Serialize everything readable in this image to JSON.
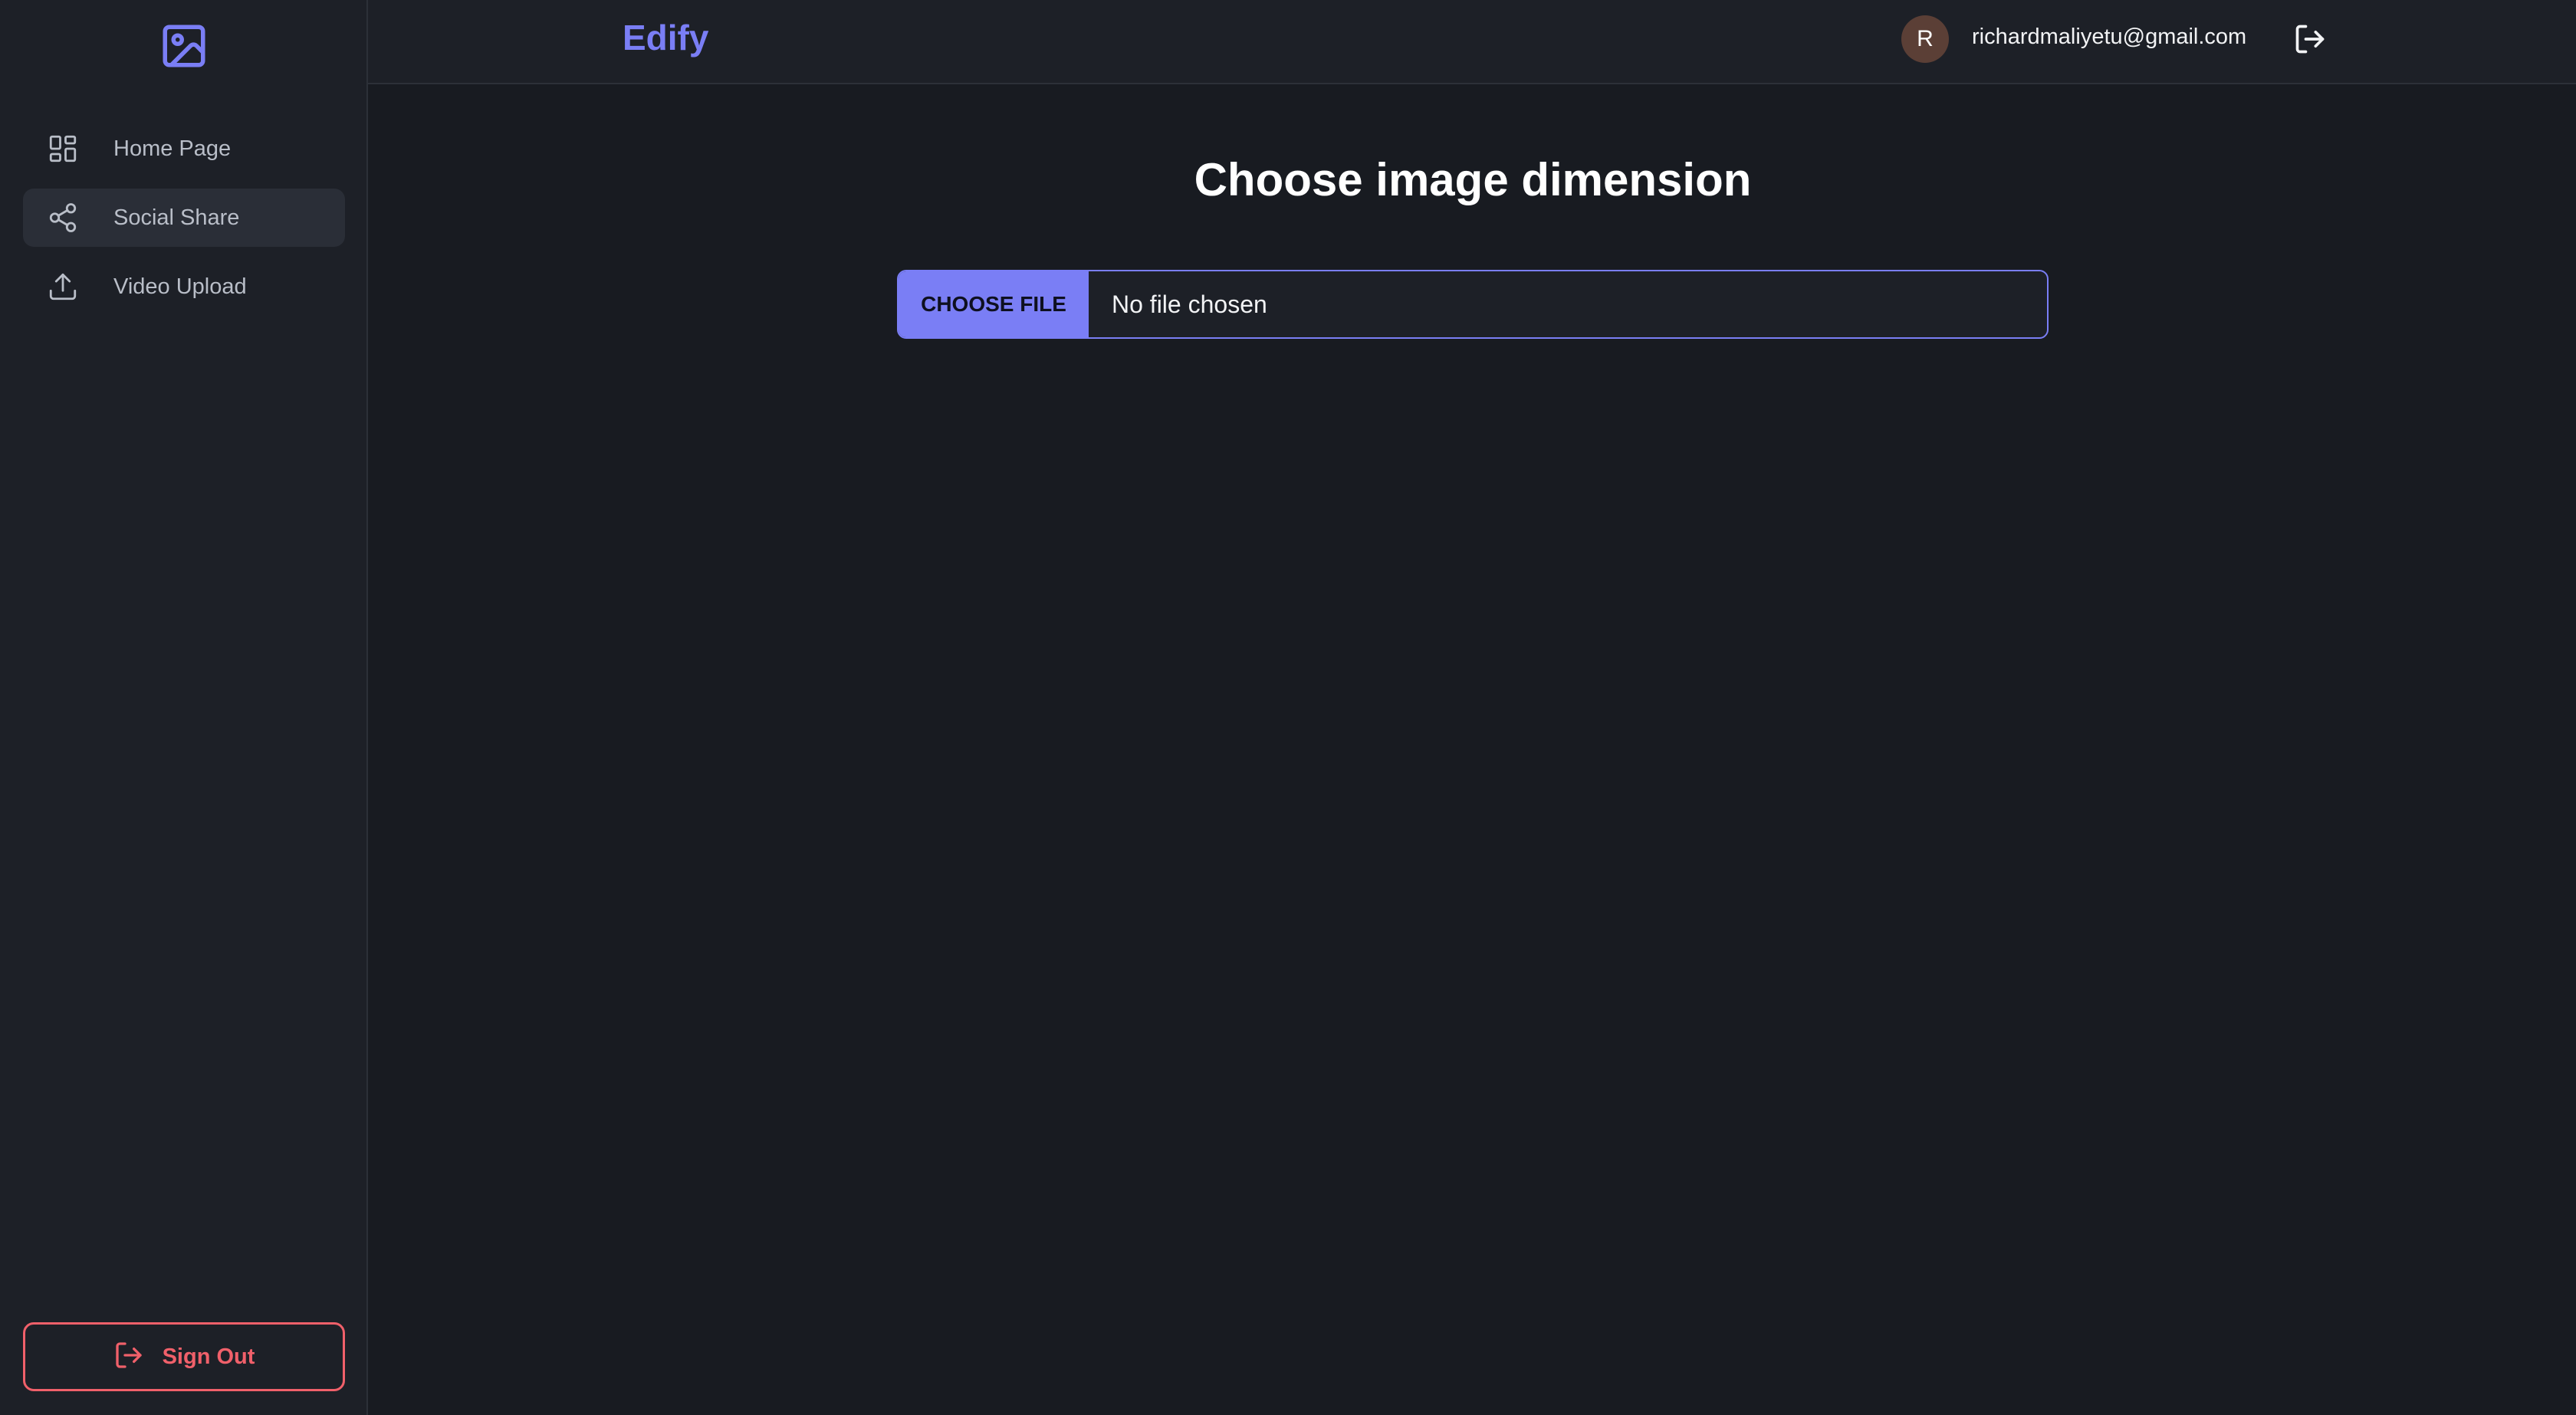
{
  "app": {
    "brand": "Edify",
    "accent_color": "#7a7ef5",
    "danger_color": "#f0606a"
  },
  "header": {
    "avatar_initial": "R",
    "user_email": "richardmaliyetu@gmail.com",
    "logout_icon": "logout-icon"
  },
  "sidebar": {
    "logo_icon": "image-icon",
    "items": [
      {
        "label": "Home Page",
        "icon": "grid-icon",
        "active": false
      },
      {
        "label": "Social Share",
        "icon": "share-icon",
        "active": true
      },
      {
        "label": "Video Upload",
        "icon": "upload-icon",
        "active": false
      }
    ],
    "sign_out_label": "Sign Out"
  },
  "main": {
    "title": "Choose image dimension",
    "file_input": {
      "button_label": "CHOOSE FILE",
      "status_text": "No file chosen"
    }
  }
}
